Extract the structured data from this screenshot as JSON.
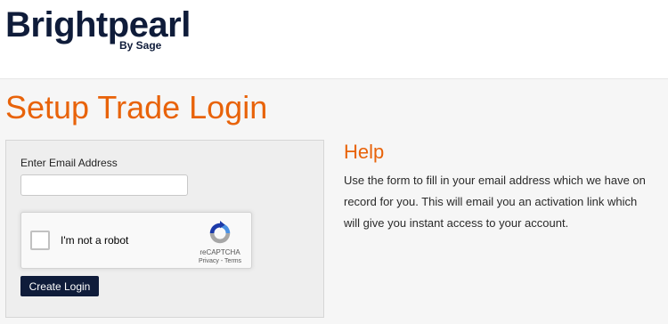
{
  "header": {
    "logo_wordmark": "Brightpearl",
    "logo_byline": "By Sage"
  },
  "page": {
    "title": "Setup Trade Login"
  },
  "form": {
    "email_label": "Enter Email Address",
    "email_value": "",
    "recaptcha": {
      "checkbox_label": "I'm not a robot",
      "brand": "reCAPTCHA",
      "links": "Privacy - Terms",
      "checked": false
    },
    "submit_label": "Create Login"
  },
  "help": {
    "title": "Help",
    "line1": "Use the form to fill in your email address which we have on",
    "line2": "record for you. This will email you an activation link which",
    "line3": "will give you instant access to your account."
  },
  "colors": {
    "brand_navy": "#0f1c3a",
    "accent_orange": "#e8630a",
    "page_bg": "#f6f6f6"
  }
}
